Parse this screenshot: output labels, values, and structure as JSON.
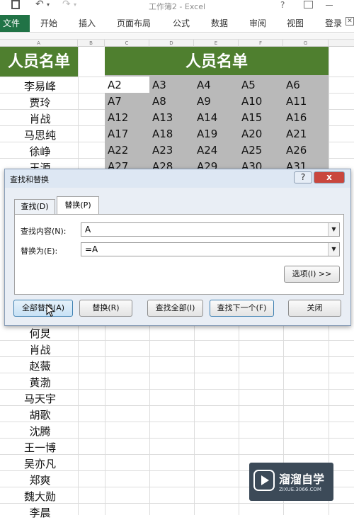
{
  "window": {
    "title": "工作簿2 - Excel",
    "help": "?"
  },
  "ribbon": {
    "file": "文件",
    "tabs": [
      "开始",
      "插入",
      "页面布局",
      "公式",
      "数据",
      "审阅",
      "视图"
    ],
    "login": "登录"
  },
  "columns": [
    "A",
    "B",
    "C",
    "D",
    "E",
    "F",
    "G"
  ],
  "left_list": {
    "header": "人员名单",
    "names_top": [
      "李易峰",
      "贾玲",
      "肖战",
      "马思纯",
      "徐峥",
      "王源"
    ],
    "names_bottom": [
      "何炅",
      "肖战",
      "赵薇",
      "黄渤",
      "马天宇",
      "胡歌",
      "沈腾",
      "王一博",
      "吴亦凡",
      "郑爽",
      "魏大勋",
      "李晨"
    ]
  },
  "right_table": {
    "header": "人员名单",
    "rows": [
      [
        "A2",
        "A3",
        "A4",
        "A5",
        "A6"
      ],
      [
        "A7",
        "A8",
        "A9",
        "A10",
        "A11"
      ],
      [
        "A12",
        "A13",
        "A14",
        "A15",
        "A16"
      ],
      [
        "A17",
        "A18",
        "A19",
        "A20",
        "A21"
      ],
      [
        "A22",
        "A23",
        "A24",
        "A25",
        "A26"
      ],
      [
        "A27",
        "A28",
        "A29",
        "A30",
        "A31"
      ]
    ],
    "fill_color": "#b9b9b9",
    "header_color": "#4f7f2f"
  },
  "dialog": {
    "title": "查找和替换",
    "help": "?",
    "close": "x",
    "tabs": {
      "find": "查找(D)",
      "replace": "替换(P)"
    },
    "find_label": "查找内容(N):",
    "find_value": "A",
    "replace_label": "替换为(E):",
    "replace_value": "=A",
    "options_button": "选项(I) >>",
    "buttons": {
      "replace_all": "全部替换(A)",
      "replace": "替换(R)",
      "find_all": "查找全部(I)",
      "find_next": "查找下一个(F)",
      "close": "关闭"
    }
  },
  "watermark": {
    "brand": "溜溜自学",
    "url": "ZIXUE.3066.COM"
  }
}
